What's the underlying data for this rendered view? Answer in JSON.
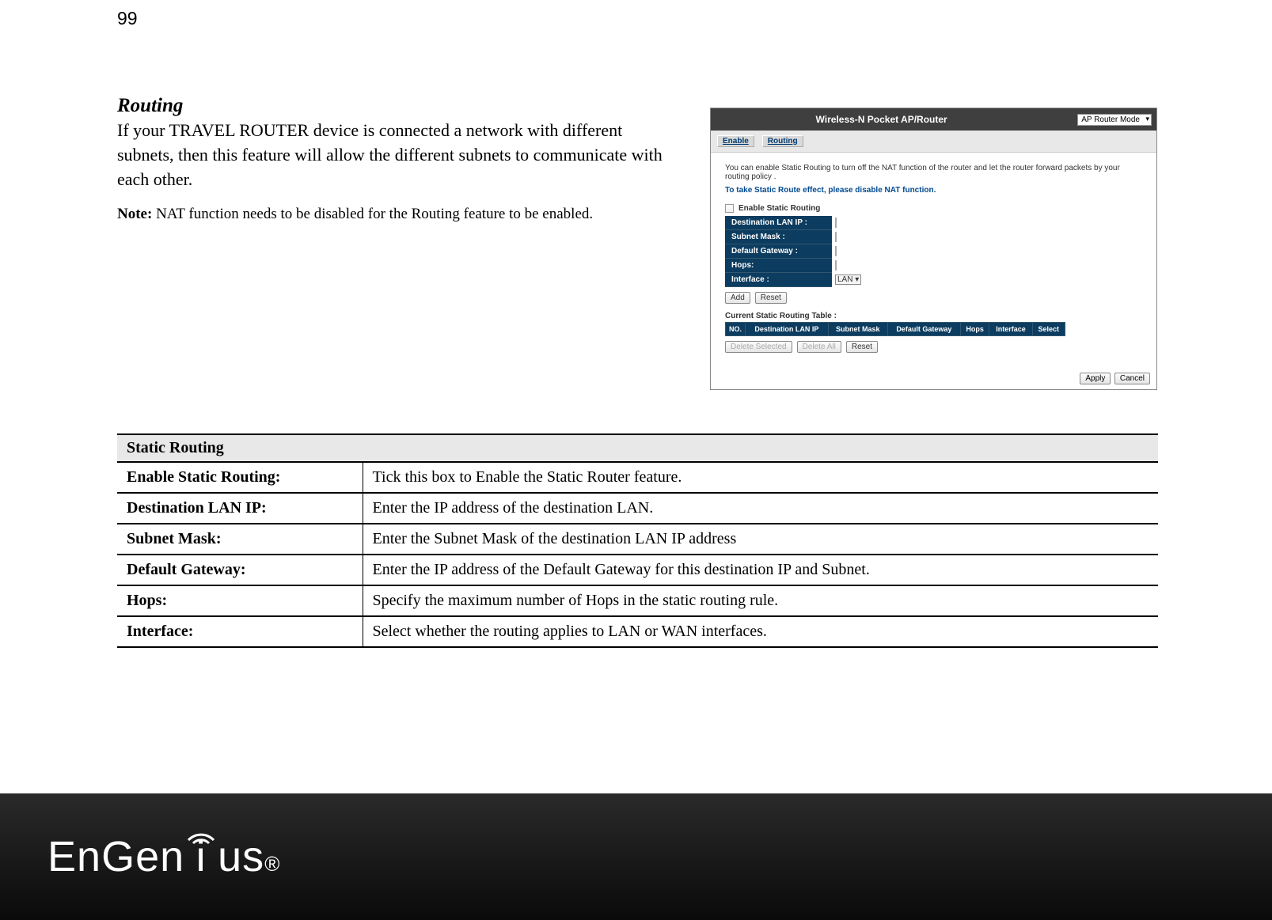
{
  "page_number": "99",
  "heading": "Routing",
  "intro": "If your TRAVEL ROUTER device is connected a network with different subnets, then this feature will allow the different subnets to communicate with each other.",
  "note_label": "Note:",
  "note_text": " NAT function needs to be disabled for the Routing feature to be enabled.",
  "shot": {
    "title": "Wireless-N Pocket AP/Router",
    "mode": "AP Router Mode",
    "tabs": {
      "enable": "Enable",
      "routing": "Routing"
    },
    "desc": "You can enable Static Routing to turn off the NAT function of the router and let the router forward packets by your routing policy .",
    "warn": "To take Static Route effect, please disable NAT function.",
    "chk_label": "Enable Static Routing",
    "form": {
      "dest": "Destination LAN IP :",
      "mask": "Subnet Mask :",
      "gw": "Default Gateway :",
      "hops": "Hops:",
      "iface": "Interface :",
      "iface_val": "LAN"
    },
    "buttons": {
      "add": "Add",
      "reset": "Reset",
      "delete_selected": "Delete Selected",
      "delete_all": "Delete All",
      "apply": "Apply",
      "cancel": "Cancel"
    },
    "rt_caption": "Current Static Routing Table :",
    "rt_headers": {
      "no": "NO.",
      "dest": "Destination LAN IP",
      "mask": "Subnet Mask",
      "gw": "Default Gateway",
      "hops": "Hops",
      "iface": "Interface",
      "select": "Select"
    }
  },
  "table": {
    "section_head": "Static Routing",
    "rows": {
      "enable": {
        "label": "Enable Static Routing:",
        "desc": "Tick this box to Enable the Static Router feature."
      },
      "dest": {
        "label": "Destination LAN IP:",
        "desc": "Enter the IP address of the destination LAN."
      },
      "mask": {
        "label": "Subnet Mask:",
        "desc": "Enter the Subnet Mask of the destination LAN IP address"
      },
      "gw": {
        "label": "Default Gateway:",
        "desc": "Enter the IP address of the Default Gateway for this destination IP and Subnet."
      },
      "hops": {
        "label": "Hops:",
        "desc": "Specify the maximum number of Hops in the static routing rule."
      },
      "iface": {
        "label": "Interface:",
        "desc": "Select whether the routing applies to LAN or WAN interfaces."
      }
    }
  },
  "logo": {
    "text_en": "En",
    "text_gen": "Gen",
    "text_i": "i",
    "text_us": "us",
    "reg": "®"
  }
}
